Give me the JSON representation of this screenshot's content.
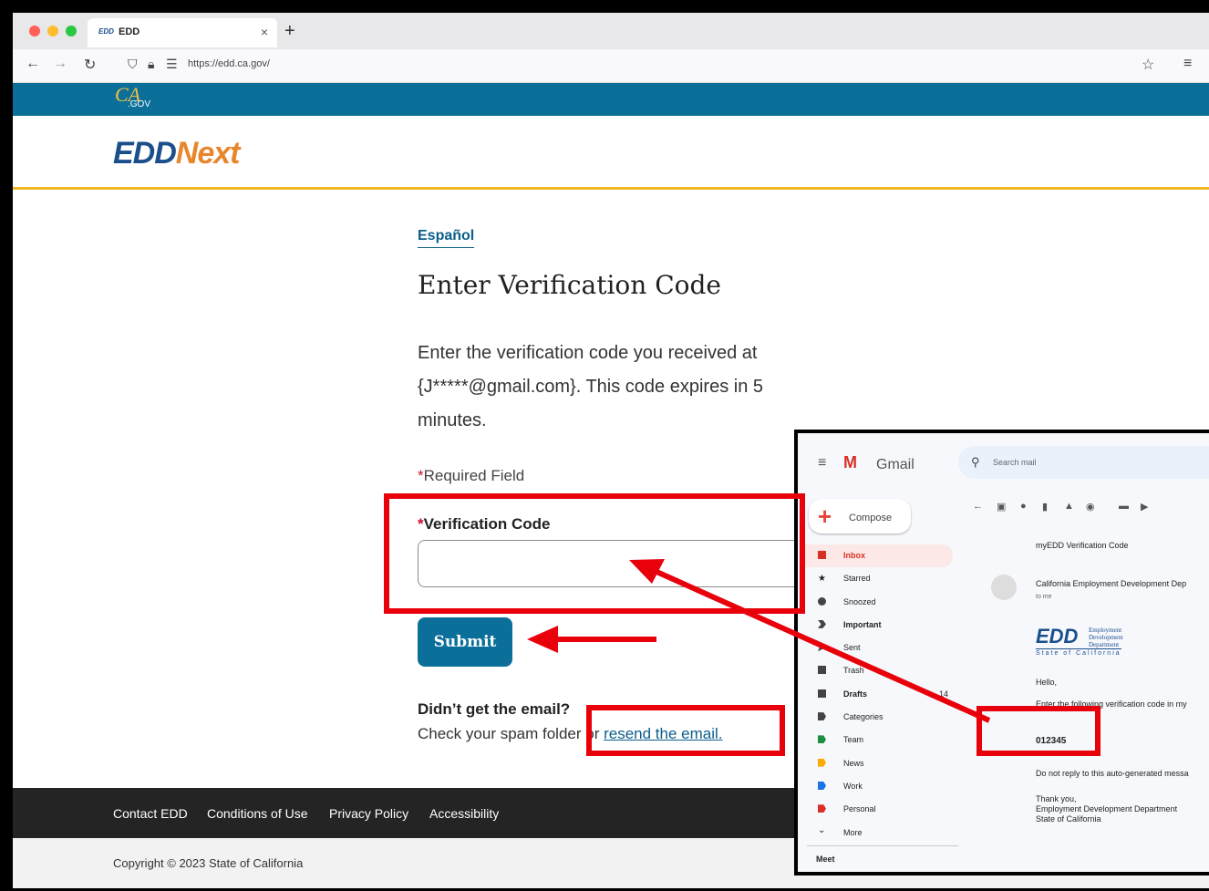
{
  "browser": {
    "tab_title": "EDD",
    "tab_favicon": "EDD",
    "tab_close": "×",
    "new_tab": "+",
    "url": "https://edd.ca.gov/",
    "back_icon": "arrow-left",
    "forward_icon": "arrow-right",
    "reload_icon": "reload",
    "bookmark_icon": "star",
    "menu_icon": "hamburger"
  },
  "header": {
    "ca_logo_text": "CA",
    "ca_logo_sub": ".GOV",
    "logo_edd": "EDD",
    "logo_next": "Next"
  },
  "form": {
    "language_link": "Español",
    "title": "Enter Verification Code",
    "description": "Enter the verification code you received at {J*****@gmail.com}. This code expires in 5 minutes.",
    "required_note": "Required Field",
    "required_star": "*",
    "code_label": "Verification Code",
    "code_value": "",
    "submit_label": "Submit",
    "no_email_heading": "Didn’t get the email?",
    "spam_text": "Check your spam folder or ",
    "resend_link": "resend the email."
  },
  "footer": {
    "links": [
      "Contact EDD",
      "Conditions of Use",
      "Privacy Policy",
      "Accessibility"
    ],
    "copyright": "Copyright © 2023 State of California"
  },
  "gmail": {
    "app_name": "Gmail",
    "search_placeholder": "Search mail",
    "compose_label": "Compose",
    "sidebar": [
      {
        "label": "Inbox",
        "count": "",
        "color": "#d93025",
        "active": true
      },
      {
        "label": "Starred",
        "count": "",
        "color": "#444"
      },
      {
        "label": "Snoozed",
        "count": "",
        "color": "#444"
      },
      {
        "label": "Important",
        "count": "",
        "color": "#444"
      },
      {
        "label": "Sent",
        "count": "",
        "color": "#444"
      },
      {
        "label": "Trash",
        "count": "",
        "color": "#444"
      },
      {
        "label": "Drafts",
        "count": "14",
        "color": "#444"
      },
      {
        "label": "Categories",
        "count": "",
        "color": "#444"
      },
      {
        "label": "Team",
        "count": "",
        "color": "#1e8e3e"
      },
      {
        "label": "News",
        "count": "",
        "color": "#f9ab00"
      },
      {
        "label": "Work",
        "count": "",
        "color": "#1a73e8"
      },
      {
        "label": "Personal",
        "count": "",
        "color": "#d93025"
      },
      {
        "label": "More",
        "count": "",
        "color": "#444"
      }
    ],
    "meet_label": "Meet",
    "email": {
      "subject": "myEDD Verification Code",
      "sender": "California Employment Development Dep",
      "to": "to me",
      "logo_text": "EDD",
      "logo_side": [
        "Employment",
        "Development",
        "Department"
      ],
      "logo_state": "State of California",
      "greeting": "Hello,",
      "instruction": "Enter the following verification code in my",
      "code": "012345",
      "notice": "Do not reply to this auto-generated messa",
      "signoff": [
        "Thank you,",
        "Employment Development Department",
        "State of California"
      ]
    }
  },
  "colors": {
    "ca_blue": "#0b6f9a",
    "gold_rule": "#f2b824",
    "annotation_red": "#e8000b"
  }
}
